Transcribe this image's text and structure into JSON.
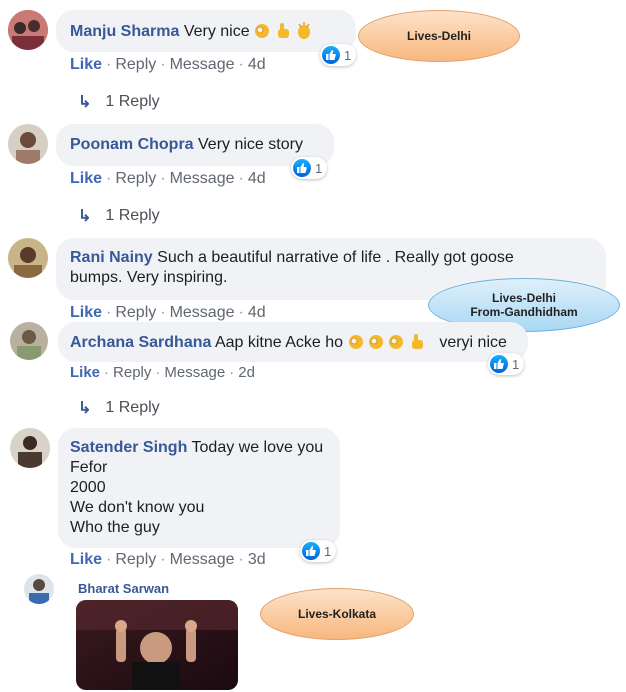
{
  "actions": {
    "like": "Like",
    "reply": "Reply",
    "message": "Message",
    "sep": "·"
  },
  "comments": [
    {
      "name": "Manju Sharma",
      "text": "Very nice",
      "time": "4d",
      "reactions": "1",
      "replies": "1 Reply"
    },
    {
      "name": "Poonam Chopra",
      "text": "Very nice story",
      "time": "4d",
      "reactions": "1",
      "replies": "1 Reply"
    },
    {
      "name": "Rani Nainy",
      "text": "Such a beautiful narrative of life . Really got goose",
      "text2": "bumps. Very inspiring.",
      "time": "4d"
    },
    {
      "name": "Archana Sardhana",
      "text": "Aap kitne Acke ho",
      "text_after": "veryi nice",
      "time": "2d",
      "reactions": "1",
      "replies": "1 Reply"
    },
    {
      "name": "Satender Singh",
      "text": "Today we love you",
      "lines": [
        "Fefor",
        "2000",
        "We don't know you",
        "Who the guy"
      ],
      "time": "3d",
      "reactions": "1"
    },
    {
      "name": "Bharat Sarwan"
    }
  ],
  "annotations": {
    "note1": "Lives-Delhi",
    "note2_line1": "Lives-Delhi",
    "note2_line2": "From-Gandhidham",
    "note3": "Lives-Kolkata"
  },
  "colors": {
    "name": "#385898",
    "bubble": "#f0f2f5",
    "like": "#4267b2"
  }
}
